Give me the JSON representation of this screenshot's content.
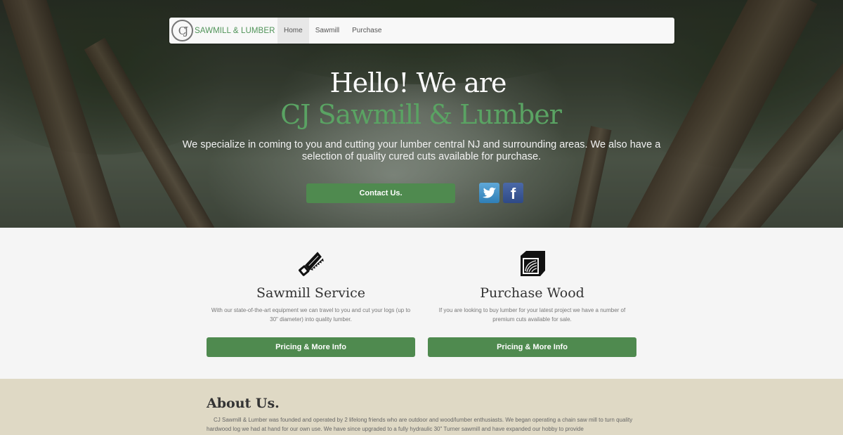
{
  "nav": {
    "brand_mark": "CJ",
    "brand_text": "SAWMILL & LUMBER",
    "items": [
      {
        "label": "Home",
        "active": true
      },
      {
        "label": "Sawmill",
        "active": false
      },
      {
        "label": "Purchase",
        "active": false
      }
    ]
  },
  "hero": {
    "heading_line1": "Hello! We are",
    "heading_line2": "CJ Sawmill & Lumber",
    "lead": "We specialize in coming to you and cutting your lumber central NJ and surrounding areas. We also have a selection of quality cured cuts available for purchase.",
    "contact_label": "Contact Us.",
    "social": [
      {
        "icon": "twitter-icon",
        "color": "#3b8fc8"
      },
      {
        "icon": "facebook-icon",
        "color": "#3b5998"
      }
    ]
  },
  "services": [
    {
      "icon": "saw-icon",
      "title": "Sawmill Service",
      "description": "With our state-of-the-art equipment we can travel to you and cut your logs (up to 30\" diameter) into quality lumber.",
      "button": "Pricing & More Info"
    },
    {
      "icon": "wood-log-icon",
      "title": "Purchase Wood",
      "description": "If you are looking to buy lumber for your latest project we have a number of premium cuts available for sale.",
      "button": "Pricing & More Info"
    }
  ],
  "about": {
    "title": "About Us.",
    "text": "CJ Sawmill & Lumber was founded and operated by 2 lifelong friends who are outdoor and wood/lumber enthusiasts. We began operating a chain saw mill to turn quality hardwood log we had at hand for our own use. We have since upgraded to a fully hydraulic 30\" Turner sawmill and have expanded our hobby to provide"
  },
  "colors": {
    "accent_green": "#4f8a4f",
    "heading_green": "#5aa363",
    "about_bg": "#dfd9c5"
  }
}
